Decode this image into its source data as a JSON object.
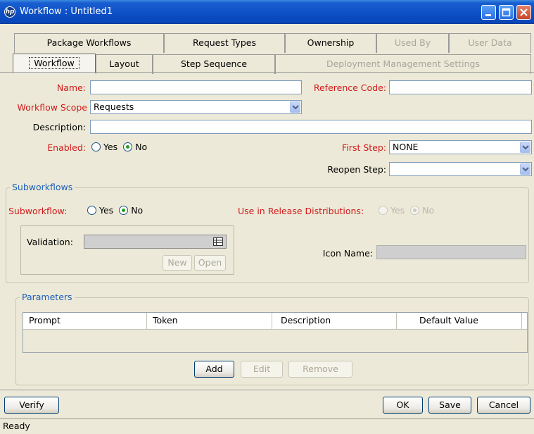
{
  "window": {
    "title": "Workflow : Untitled1",
    "logo_text": "hp"
  },
  "tabs_row1": [
    {
      "label": "Package Workflows",
      "enabled": true
    },
    {
      "label": "Request Types",
      "enabled": true
    },
    {
      "label": "Ownership",
      "enabled": true
    },
    {
      "label": "Used By",
      "enabled": false
    },
    {
      "label": "User Data",
      "enabled": false
    }
  ],
  "tabs_row2": [
    {
      "label": "Workflow",
      "enabled": true,
      "active": true
    },
    {
      "label": "Layout",
      "enabled": true
    },
    {
      "label": "Step Sequence",
      "enabled": true
    },
    {
      "label": "Deployment Management Settings",
      "enabled": false
    }
  ],
  "form": {
    "name_label": "Name:",
    "name_value": "",
    "reference_code_label": "Reference Code:",
    "reference_code_value": "",
    "workflow_scope_label": "Workflow Scope",
    "workflow_scope_value": "Requests",
    "description_label": "Description:",
    "description_value": "",
    "enabled_label": "Enabled:",
    "enabled_yes": "Yes",
    "enabled_no": "No",
    "enabled_selected": "No",
    "first_step_label": "First Step:",
    "first_step_value": "NONE",
    "reopen_step_label": "Reopen Step:",
    "reopen_step_value": ""
  },
  "subworkflows": {
    "title": "Subworkflows",
    "subworkflow_label": "Subworkflow:",
    "yes": "Yes",
    "no": "No",
    "subworkflow_selected": "No",
    "release_label": "Use in Release Distributions:",
    "release_yes": "Yes",
    "release_no": "No",
    "release_selected": "No",
    "validation_label": "Validation:",
    "validation_value": "",
    "new_button": "New",
    "open_button": "Open",
    "icon_name_label": "Icon Name:",
    "icon_name_value": ""
  },
  "parameters": {
    "title": "Parameters",
    "columns": [
      "Prompt",
      "Token",
      "Description",
      "Default Value"
    ],
    "rows": [],
    "add_button": "Add",
    "edit_button": "Edit",
    "remove_button": "Remove"
  },
  "footer": {
    "verify_button": "Verify",
    "ok_button": "OK",
    "save_button": "Save",
    "cancel_button": "Cancel"
  },
  "status": {
    "text": "Ready"
  },
  "colors": {
    "required_label": "#d11a1a",
    "group_title": "#1d5fb8",
    "titlebar": "#0b4ec6",
    "window_bg": "#ece9d8"
  }
}
